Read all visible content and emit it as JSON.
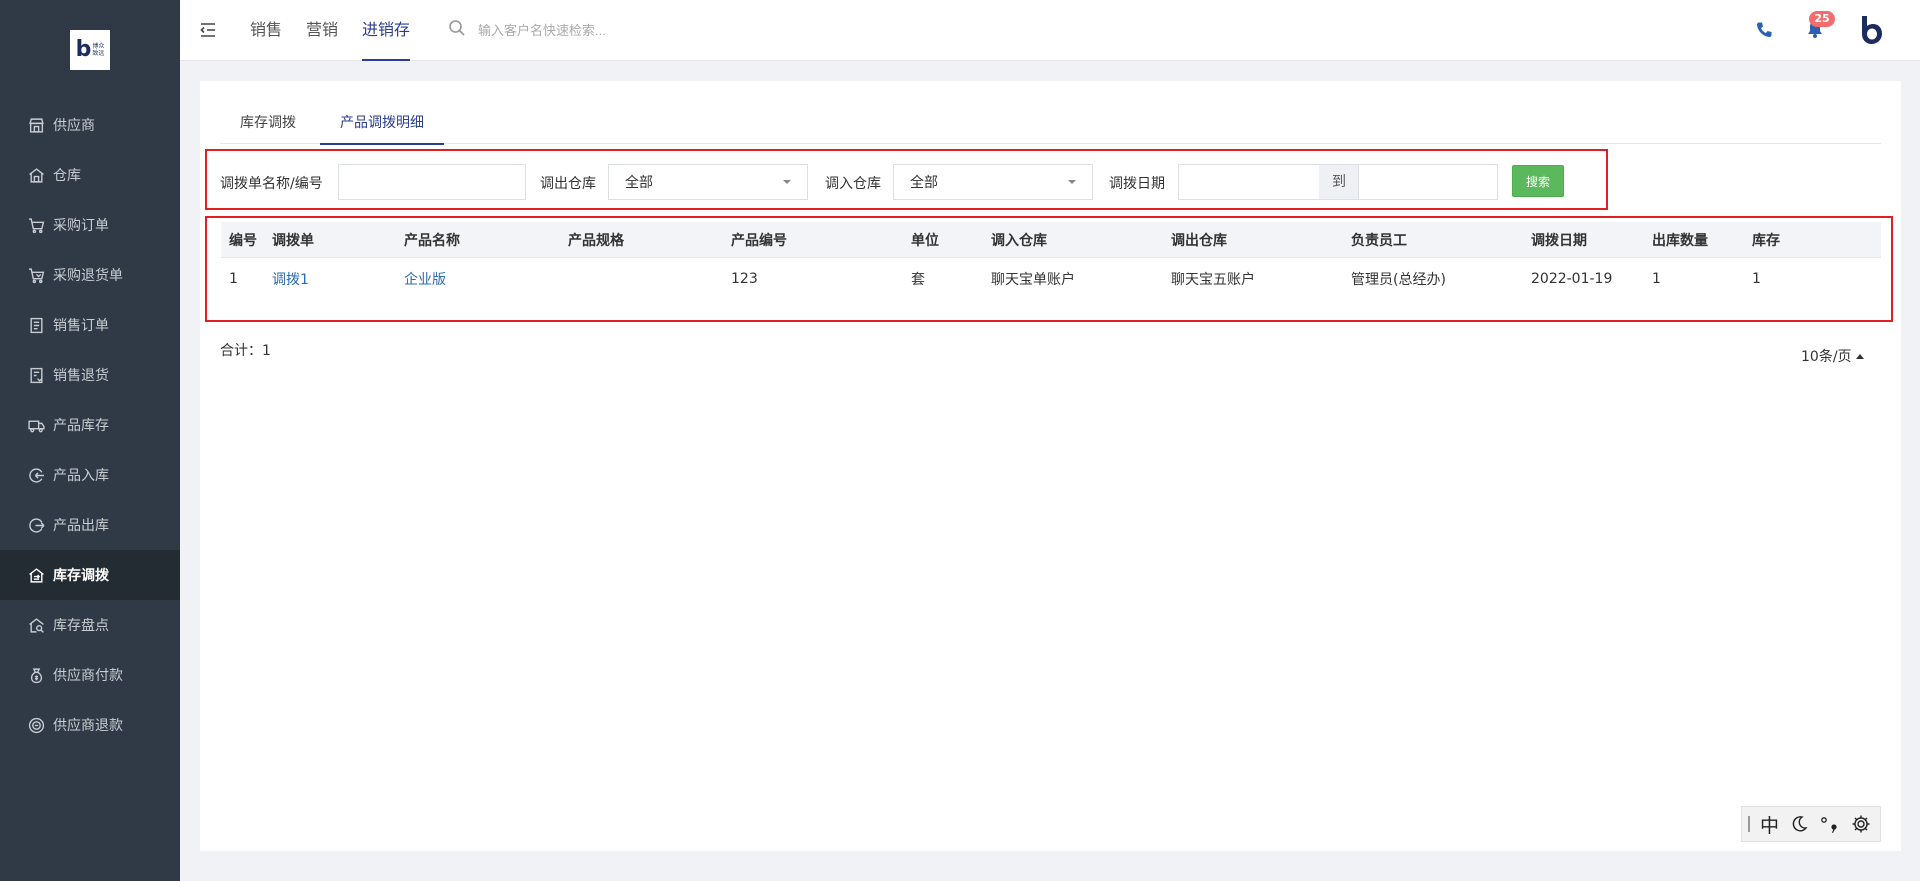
{
  "logo": {
    "letter": "b",
    "line1": "博众",
    "line2": "致远"
  },
  "sidebar": {
    "items": [
      {
        "label": "供应商",
        "icon": "store-icon",
        "active": false
      },
      {
        "label": "仓库",
        "icon": "warehouse-icon",
        "active": false
      },
      {
        "label": "采购订单",
        "icon": "cart-icon",
        "active": false
      },
      {
        "label": "采购退货单",
        "icon": "cart-return-icon",
        "active": false
      },
      {
        "label": "销售订单",
        "icon": "document-list-icon",
        "active": false
      },
      {
        "label": "销售退货",
        "icon": "document-return-icon",
        "active": false
      },
      {
        "label": "产品库存",
        "icon": "truck-icon",
        "active": false
      },
      {
        "label": "产品入库",
        "icon": "inbound-icon",
        "active": false
      },
      {
        "label": "产品出库",
        "icon": "outbound-icon",
        "active": false
      },
      {
        "label": "库存调拨",
        "icon": "transfer-house-icon",
        "active": true
      },
      {
        "label": "库存盘点",
        "icon": "inventory-check-icon",
        "active": false
      },
      {
        "label": "供应商付款",
        "icon": "money-bag-icon",
        "active": false
      },
      {
        "label": "供应商退款",
        "icon": "refund-icon",
        "active": false
      }
    ]
  },
  "topbar": {
    "nav": [
      {
        "label": "销售",
        "active": false
      },
      {
        "label": "营销",
        "active": false
      },
      {
        "label": "进销存",
        "active": true
      }
    ],
    "search_placeholder": "输入客户名快速检索...",
    "notification_count": "25"
  },
  "tabs": [
    {
      "label": "库存调拨",
      "active": false
    },
    {
      "label": "产品调拨明细",
      "active": true
    }
  ],
  "filters": {
    "name_label": "调拨单名称/编号",
    "name_value": "",
    "out_warehouse_label": "调出仓库",
    "out_warehouse_value": "全部",
    "in_warehouse_label": "调入仓库",
    "in_warehouse_value": "全部",
    "date_label": "调拨日期",
    "date_from": "",
    "date_sep": "到",
    "date_to": "",
    "search_button": "搜索"
  },
  "table": {
    "columns": [
      "编号",
      "调拨单",
      "产品名称",
      "产品规格",
      "产品编号",
      "单位",
      "调入仓库",
      "调出仓库",
      "负责员工",
      "调拨日期",
      "出库数量",
      "库存"
    ],
    "rows": [
      [
        "1",
        "调拨1",
        "企业版",
        "",
        "123",
        "套",
        "聊天宝单账户",
        "聊天宝五账户",
        "管理员(总经办)",
        "2022-01-19",
        "1",
        "1"
      ]
    ]
  },
  "footer": {
    "total_label": "合计：1",
    "page_size": "10条/页"
  },
  "ime": {
    "mode": "中"
  },
  "colors": {
    "sidebar_bg": "#2f3a46",
    "accent": "#2c3e8f",
    "link": "#2b6cb0",
    "search_btn": "#5cb85c",
    "highlight_border": "#e02020",
    "badge": "#f56c6c"
  }
}
